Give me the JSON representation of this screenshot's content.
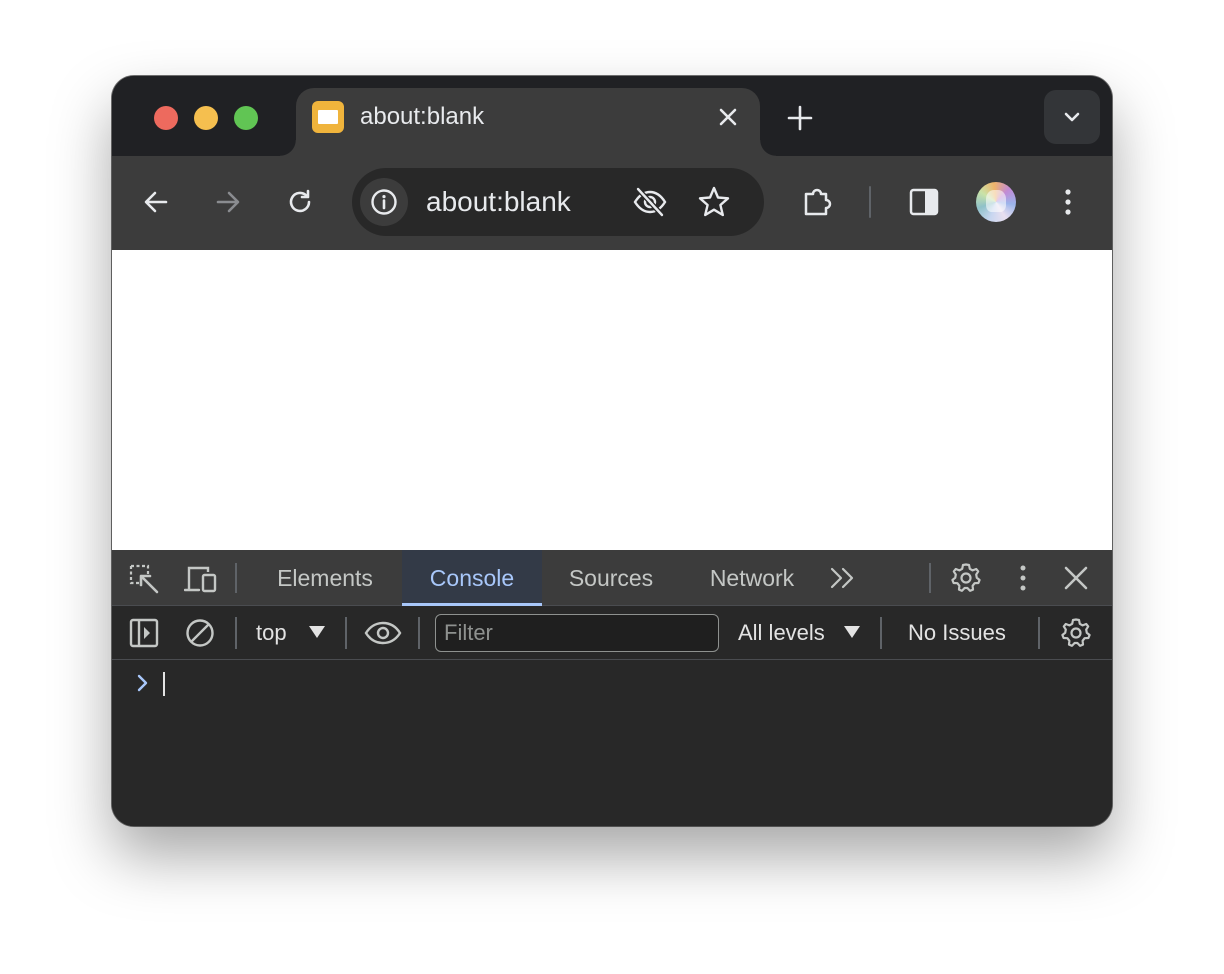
{
  "window": {
    "traffic_lights": {
      "close": "#ed6a5e",
      "minimize": "#f5bf4f",
      "maximize": "#61c554"
    }
  },
  "tab": {
    "title": "about:blank",
    "favicon": "page-favicon",
    "close_icon": "close-icon"
  },
  "tabstrip": {
    "new_tab_icon": "plus-icon",
    "tab_search_icon": "chevron-down-icon"
  },
  "toolbar": {
    "back_icon": "arrow-left-icon",
    "forward_icon": "arrow-right-icon",
    "reload_icon": "reload-icon",
    "extensions_icon": "puzzle-icon",
    "side_panel_icon": "side-panel-icon",
    "menu_icon": "kebab-menu-icon"
  },
  "omnibox": {
    "url": "about:blank",
    "site_info_icon": "info-icon",
    "tracking_icon": "eye-off-icon",
    "bookmark_icon": "star-icon"
  },
  "devtools": {
    "tabs": [
      {
        "label": "Elements",
        "active": false
      },
      {
        "label": "Console",
        "active": true
      },
      {
        "label": "Sources",
        "active": false
      },
      {
        "label": "Network",
        "active": false
      }
    ],
    "more_tabs_icon": "double-chevron-right-icon",
    "console_toolbar": {
      "context": "top",
      "filter_placeholder": "Filter",
      "filter_value": "",
      "levels": "All levels",
      "issues": "No Issues"
    },
    "accent_color": "#a8c7fa"
  }
}
